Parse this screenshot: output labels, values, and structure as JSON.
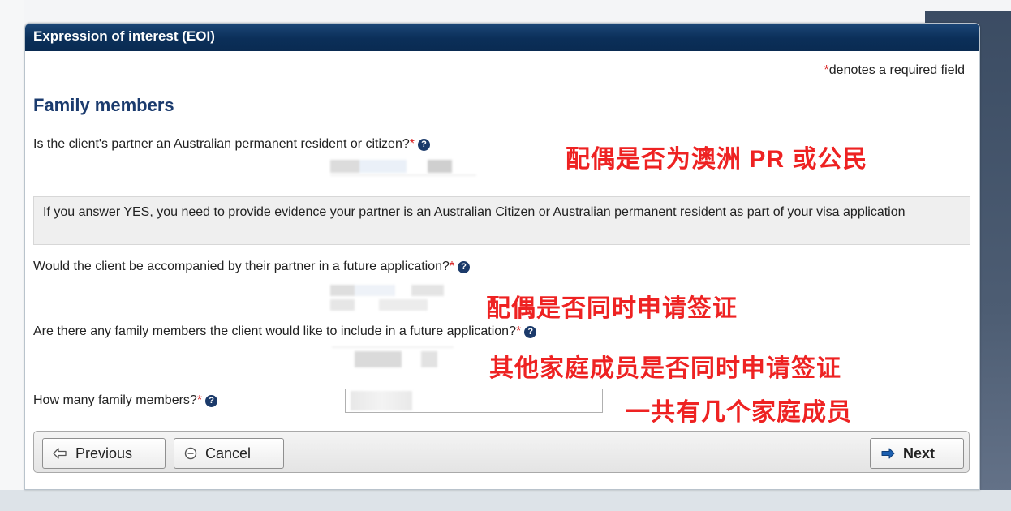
{
  "panel": {
    "title": "Expression of interest (EOI)",
    "required_note": {
      "star": "*",
      "text": "denotes a required field"
    },
    "section_title": "Family members"
  },
  "questions": {
    "q1": {
      "label": "Is the client's partner an Australian permanent resident or citizen?",
      "star": "*"
    },
    "q2": {
      "label": "Would the client be accompanied by their partner in a future application?",
      "star": "*"
    },
    "q3": {
      "label": "Are there any family members the client would like to include in a future application?",
      "star": "*"
    },
    "q4": {
      "label": "How many family members?",
      "star": "*"
    }
  },
  "help_icon_glyph": "?",
  "info_box": {
    "text": "If you answer YES, you need to provide evidence your partner is an Australian Citizen or Australian permanent resident as part of your visa application"
  },
  "annotations": {
    "a1": "配偶是否为澳洲 PR 或公民",
    "a2": "配偶是否同时申请签证",
    "a3": "其他家庭成员是否同时申请签证",
    "a4": "一共有几个家庭成员"
  },
  "buttons": {
    "previous": "Previous",
    "cancel": "Cancel",
    "next": "Next"
  },
  "colors": {
    "header_bg": "#0b2f59",
    "section_title": "#1b3b6e",
    "required_star": "#d81d1d",
    "annotation": "#ee2222",
    "next_arrow": "#1b5fb0"
  }
}
